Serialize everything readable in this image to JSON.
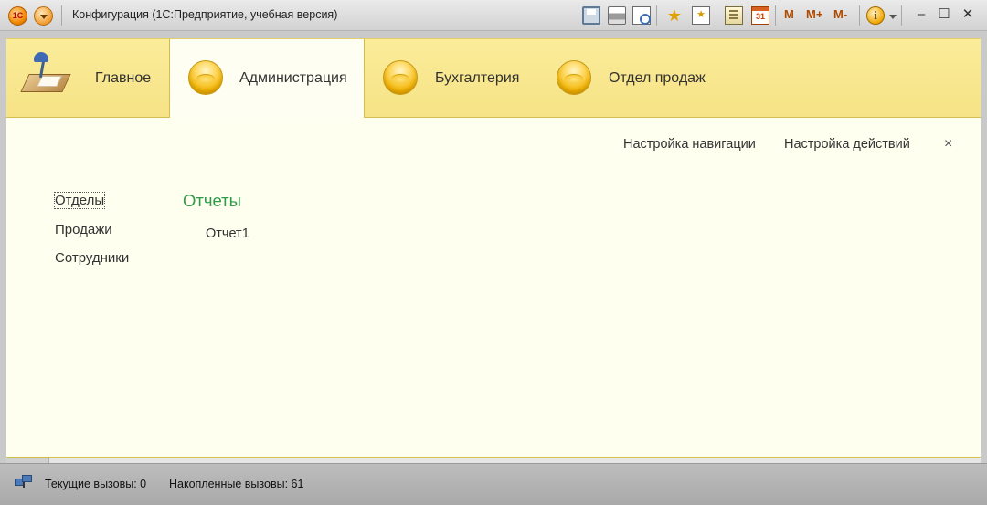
{
  "window": {
    "title": "Конфигурация  (1С:Предприятие, учебная версия)",
    "logo_text": "1С"
  },
  "toolbar": {
    "icons": [
      "save-icon",
      "print-icon",
      "preview-icon",
      "add-favorite-icon",
      "favorites-icon",
      "calculator-icon",
      "calendar-icon"
    ],
    "calendar_label": "31",
    "m_label": "M",
    "m_plus_label": "M+",
    "m_minus_label": "M-",
    "info_label": "i"
  },
  "window_buttons": {
    "minimize": "–",
    "maximize": "☐",
    "close": "✕"
  },
  "sections": [
    {
      "label": "Главное",
      "active": false
    },
    {
      "label": "Администрация",
      "active": true
    },
    {
      "label": "Бухгалтерия",
      "active": false
    },
    {
      "label": "Отдел продаж",
      "active": false
    }
  ],
  "content": {
    "commands": {
      "nav_settings": "Настройка навигации",
      "action_settings": "Настройка действий",
      "close": "×"
    },
    "nav_items": [
      {
        "label": "Отделы",
        "focused": true
      },
      {
        "label": "Продажи",
        "focused": false
      },
      {
        "label": "Сотрудники",
        "focused": false
      }
    ],
    "group_title": "Отчеты",
    "reports": [
      "Отчет1"
    ]
  },
  "status": {
    "current_calls": "Текущие вызовы: 0",
    "accumulated_calls": "Накопленные вызовы: 61"
  },
  "colors": {
    "section_bg": "#fbec9a",
    "content_bg": "#fffff0",
    "group_title": "#2e9b4a",
    "accent_orange": "#f08a00"
  }
}
